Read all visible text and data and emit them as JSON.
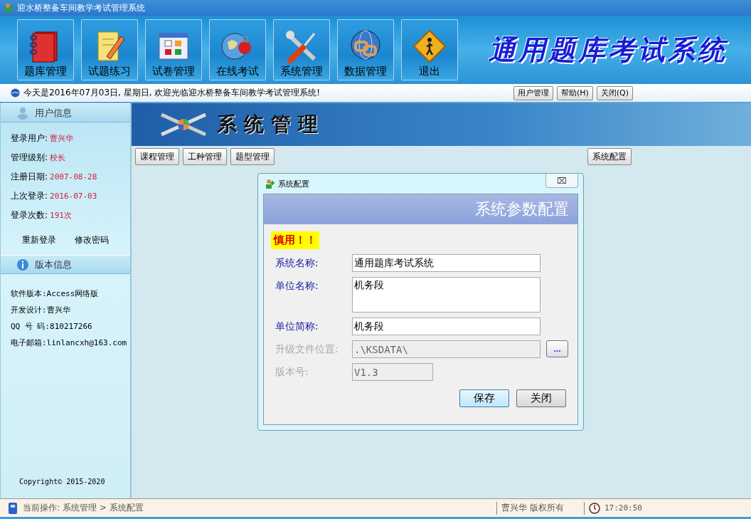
{
  "window": {
    "title": "迎水桥整备车间教学考试管理系统"
  },
  "toolbar": [
    {
      "label": "题库管理"
    },
    {
      "label": "试题练习"
    },
    {
      "label": "试卷管理"
    },
    {
      "label": "在线考试"
    },
    {
      "label": "系统管理"
    },
    {
      "label": "数据管理"
    },
    {
      "label": "退出"
    }
  ],
  "banner": {
    "title": "通用题库考试系统"
  },
  "info_bar": {
    "message": "今天是2016年07月03日, 星期日, 欢迎光临迎水桥整备车间教学考试管理系统!",
    "buttons": [
      "用户管理",
      "帮助(H)",
      "关闭(Q)"
    ]
  },
  "sidebar": {
    "user_section": {
      "title": "用户信息",
      "rows": [
        {
          "label": "登录用户:",
          "value": "曹兴华"
        },
        {
          "label": "管理级别:",
          "value": "校长"
        },
        {
          "label": "注册日期:",
          "value": "2007-08-28"
        },
        {
          "label": "上次登录:",
          "value": "2016-07-03"
        },
        {
          "label": "登录次数:",
          "value": "191次"
        }
      ],
      "links": [
        "重新登录",
        "修改密码"
      ]
    },
    "version_section": {
      "title": "版本信息",
      "lines": [
        "软件版本:Access网络版",
        "开发设计:曹兴华",
        "QQ 号 码:810217266",
        "电子邮箱:linlancxh@163.com"
      ]
    },
    "copyright": "Copyright© 2015-2020"
  },
  "content": {
    "header_title": "系统管理",
    "tabs": [
      {
        "label": "课程管理"
      },
      {
        "label": "工种管理"
      },
      {
        "label": "题型管理"
      }
    ],
    "right_button": "系统配置"
  },
  "dialog": {
    "title": "系统配置",
    "close": "⌧",
    "heading": "系统参数配置",
    "warning": "慎用！！",
    "fields": [
      {
        "kind": "text",
        "label": "系统名称:",
        "value": "通用题库考试系统",
        "disabled": false
      },
      {
        "kind": "textarea",
        "label": "单位名称:",
        "value": "机务段",
        "disabled": false
      },
      {
        "kind": "text",
        "label": "单位简称:",
        "value": "机务段",
        "disabled": false
      },
      {
        "kind": "browse",
        "label": "升级文件位置:",
        "value": ".\\KSDATA\\",
        "disabled": true,
        "button": "..."
      },
      {
        "kind": "short",
        "label": "版本号:",
        "value": "V1.3",
        "disabled": true
      }
    ],
    "buttons": [
      {
        "label": "保存",
        "selected": true
      },
      {
        "label": "关闭",
        "selected": false
      }
    ]
  },
  "status_bar": {
    "operation": "当前操作: 系统管理 > 系统配置",
    "copyright": "曹兴华 版权所有",
    "time": "17:20:50"
  }
}
